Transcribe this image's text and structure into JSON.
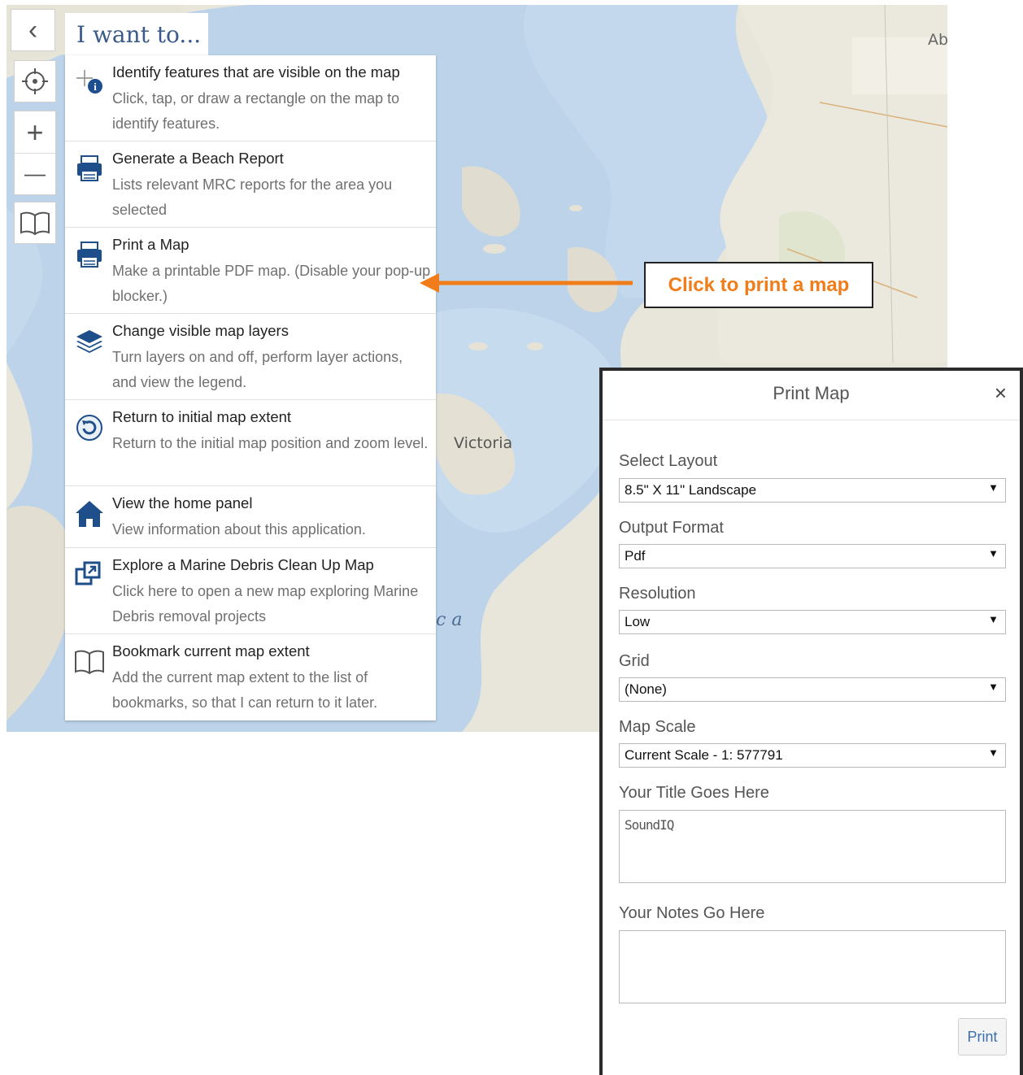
{
  "map": {
    "labels": {
      "victoria": "Victoria",
      "ab": "Ab",
      "ca": "c a"
    }
  },
  "toolbar": {
    "back_glyph": "‹",
    "zoom_in_glyph": "+",
    "zoom_out_glyph": "—"
  },
  "iwant": {
    "title": "I want to...",
    "items": [
      {
        "icon": "identify-icon",
        "title": "Identify features that are visible on the map",
        "desc": "Click, tap, or draw a rectangle on the map to identify features."
      },
      {
        "icon": "printer-icon",
        "title": "Generate a Beach Report",
        "desc": "Lists relevant MRC reports for the area you selected"
      },
      {
        "icon": "printer-icon",
        "title": "Print a Map",
        "desc": "Make a printable PDF map. (Disable your pop-up blocker.)"
      },
      {
        "icon": "layers-icon",
        "title": "Change visible map layers",
        "desc": "Turn layers on and off, perform layer actions, and view the legend."
      },
      {
        "icon": "refresh-icon",
        "title": "Return to initial map extent",
        "desc": "Return to the initial map position and zoom level."
      },
      {
        "icon": "home-icon",
        "title": "View the home panel",
        "desc": "View information about this application."
      },
      {
        "icon": "external-link-icon",
        "title": "Explore a Marine Debris Clean Up Map",
        "desc": "Click here to open a new map exploring Marine Debris removal projects"
      },
      {
        "icon": "bookmark-icon",
        "title": "Bookmark current map extent",
        "desc": "Add the current map extent to the list of bookmarks, so that I can return to it later."
      }
    ]
  },
  "annotation": {
    "text": "Click to print a map",
    "color": "#f07d1a"
  },
  "print_dialog": {
    "title": "Print Map",
    "close_glyph": "×",
    "layout_label": "Select Layout",
    "layout_value": "8.5\" X 11\" Landscape",
    "format_label": "Output Format",
    "format_value": "Pdf",
    "resolution_label": "Resolution",
    "resolution_value": "Low",
    "grid_label": "Grid",
    "grid_value": "(None)",
    "scale_label": "Map Scale",
    "scale_value": "Current Scale - 1: 577791",
    "title_label": "Your Title Goes Here",
    "title_value": "SoundIQ",
    "notes_label": "Your Notes Go Here",
    "notes_value": "",
    "print_label": "Print",
    "select_arrow": "▼"
  }
}
